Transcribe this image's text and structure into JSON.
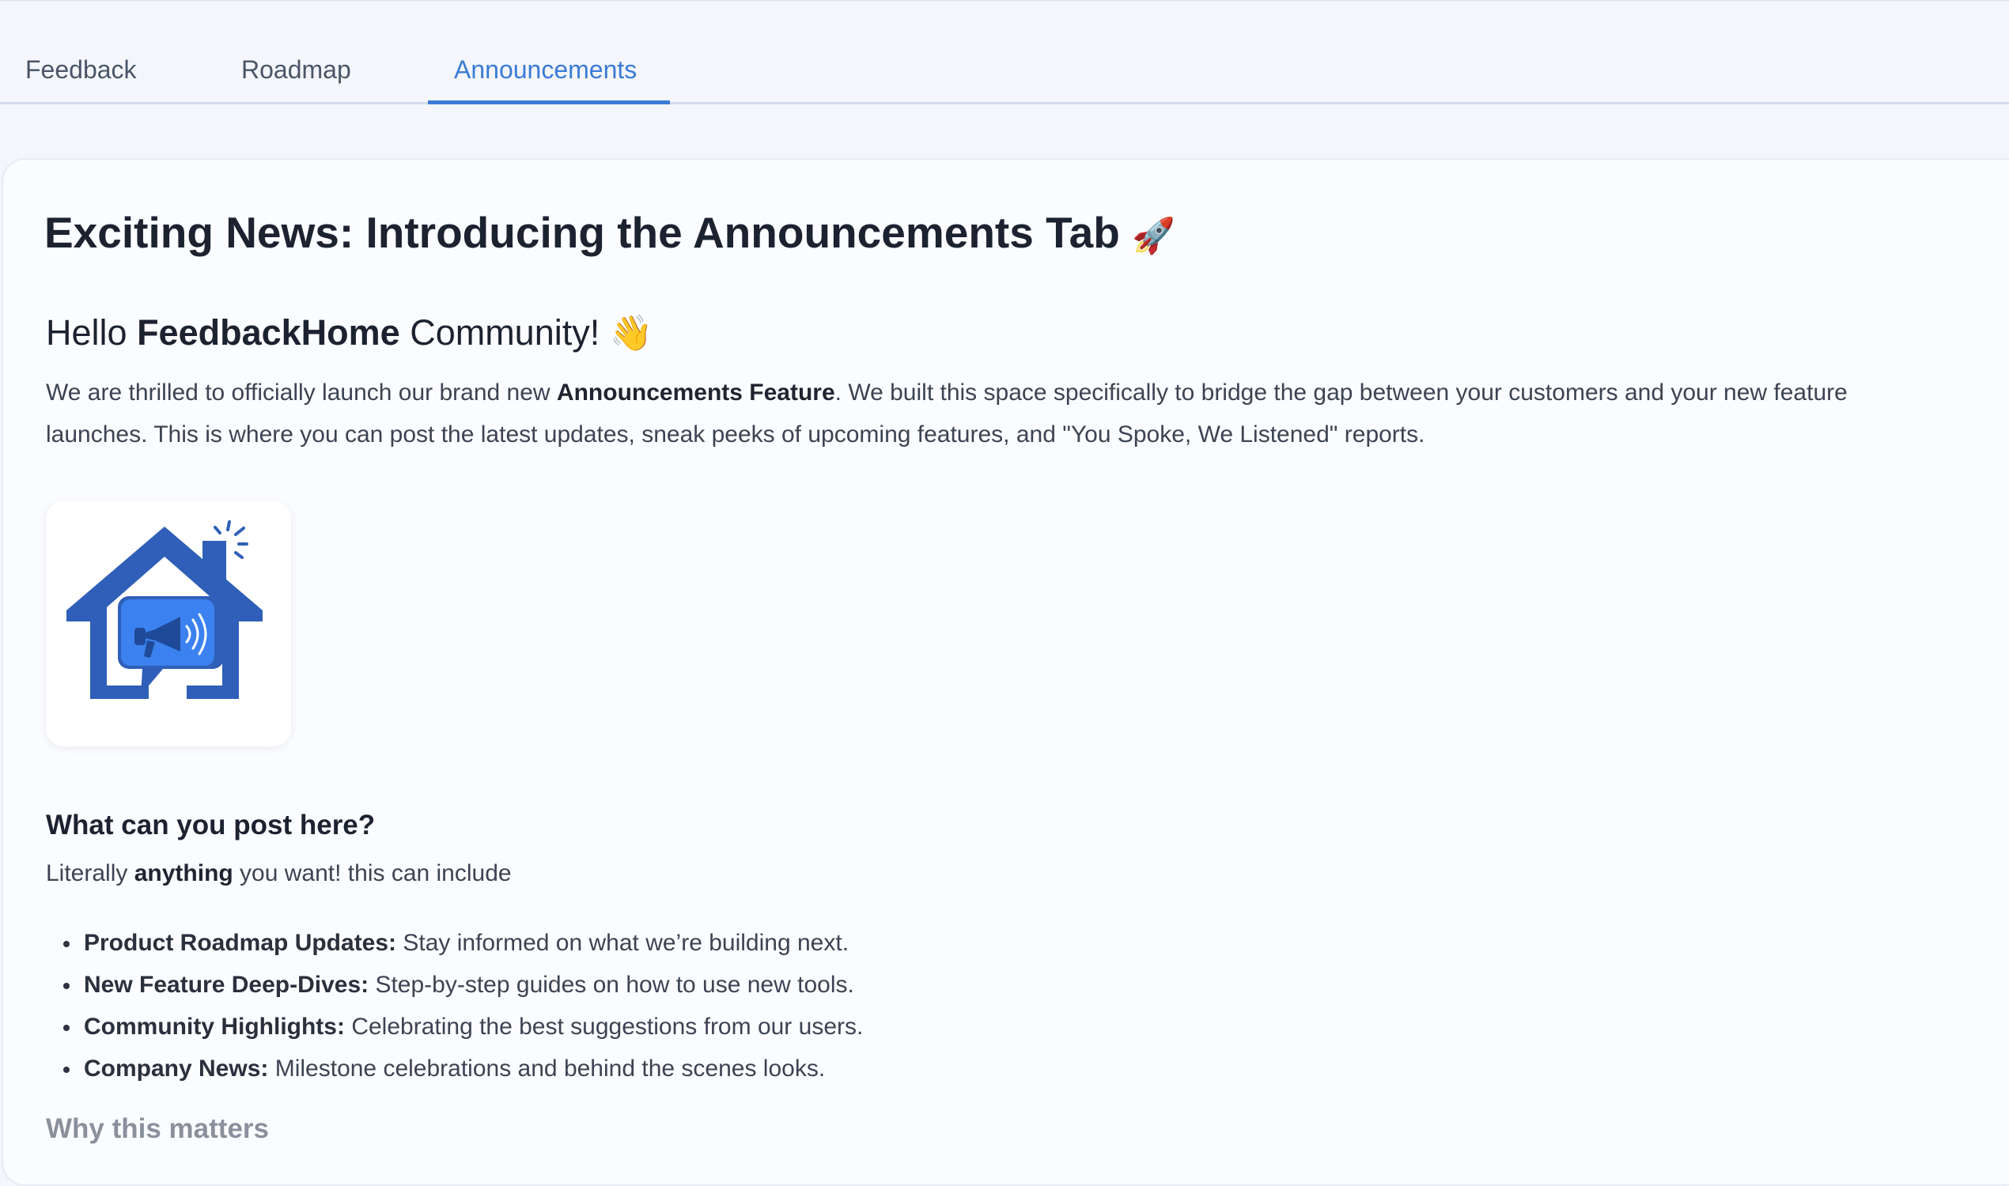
{
  "tabs": [
    {
      "label": "Feedback",
      "active": false
    },
    {
      "label": "Roadmap",
      "active": false
    },
    {
      "label": "Announcements",
      "active": true
    }
  ],
  "post": {
    "title": "Exciting News: Introducing the Announcements Tab",
    "title_emoji": "🚀",
    "greeting_prefix": "Hello ",
    "greeting_brand": "FeedbackHome",
    "greeting_suffix": " Community!",
    "greeting_emoji": "👋",
    "intro_part1": "We are thrilled to officially launch our brand new ",
    "intro_bold": "Announcements Feature",
    "intro_part2": ". We built this space specifically to bridge the gap between your customers and your new feature launches. This is where you can post the latest updates, sneak peeks of upcoming features, and \"You Spoke, We Listened\" reports.",
    "logo_icon": "house-megaphone-logo",
    "section_heading": "What can you post here?",
    "lead_part1": "Literally ",
    "lead_bold": "anything",
    "lead_part2": " you want! this can include",
    "bullets": [
      {
        "label": "Product Roadmap Updates:",
        "text": " Stay informed on what we’re building next."
      },
      {
        "label": "New Feature Deep-Dives:",
        "text": " Step-by-step guides on how to use new tools."
      },
      {
        "label": "Community Highlights:",
        "text": " Celebrating the best suggestions from our users."
      },
      {
        "label": "Company News:",
        "text": " Milestone celebrations and behind the scenes looks."
      }
    ],
    "next_heading": "Why this matters"
  },
  "colors": {
    "accent": "#3a7bd5",
    "logo_blue": "#2f5fb8",
    "logo_light_blue": "#3b82f0"
  }
}
